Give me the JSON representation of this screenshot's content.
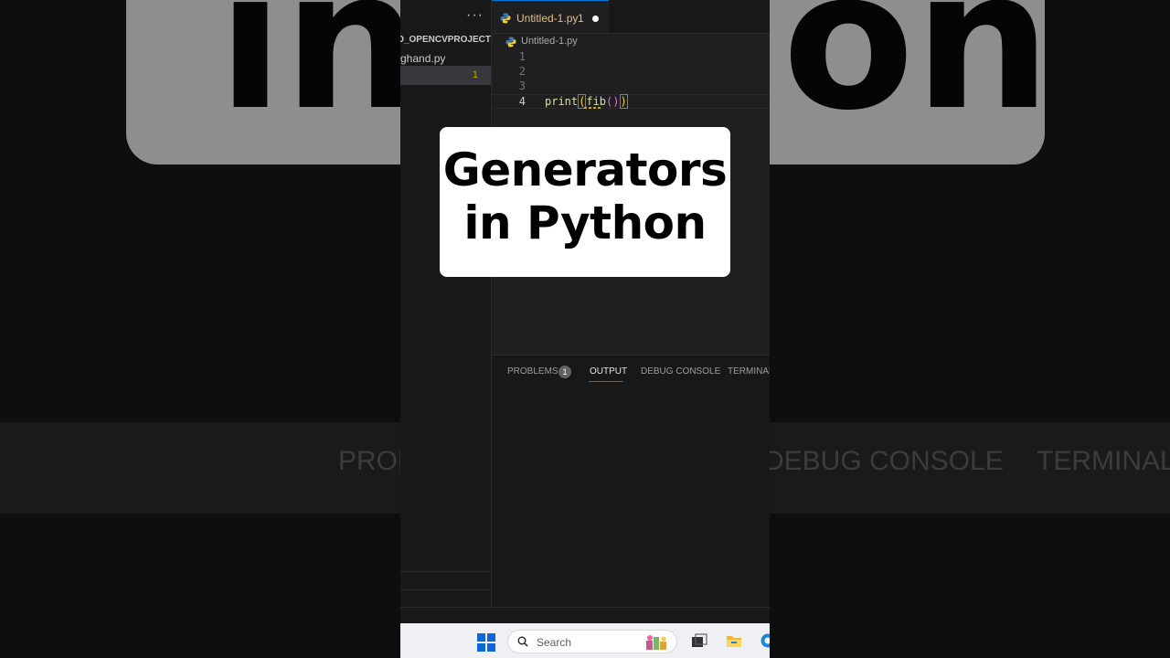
{
  "background": {
    "big_text_left": "in",
    "big_text_right": "on",
    "tabs": [
      "PROB",
      "DEBUG CONSOLE",
      "TERMINAL"
    ]
  },
  "explorer": {
    "more_glyph": "···",
    "project": "AND_OPENCVPROJECT",
    "file": "ghand.py",
    "selected_badge": "1"
  },
  "editor_tab": {
    "label": "Untitled-1.py",
    "count": "1",
    "icon": "python-icon"
  },
  "breadcrumb": "Untitled-1.py",
  "editor": {
    "lines": [
      {
        "num": "1",
        "code": ""
      },
      {
        "num": "2",
        "code": ""
      },
      {
        "num": "3",
        "code": ""
      },
      {
        "num": "4",
        "fn1": "print",
        "p1o": "(",
        "fn2": "fib",
        "p2": "()",
        "p1c": ")"
      }
    ]
  },
  "panel": {
    "problems": "PROBLEMS",
    "problems_count": "1",
    "output": "OUTPUT",
    "debug": "DEBUG CONSOLE",
    "terminal": "TERMINAL"
  },
  "taskbar": {
    "search_placeholder": "Search",
    "icons": [
      "windows-start-icon",
      "search-icon",
      "task-view-icon",
      "file-explorer-icon",
      "edge-icon"
    ]
  },
  "overlay": {
    "line1": "Generators",
    "line2": "in Python"
  },
  "colors": {
    "accent": "#0078d4",
    "modified": "#e2c08d",
    "warning": "#cca700"
  }
}
